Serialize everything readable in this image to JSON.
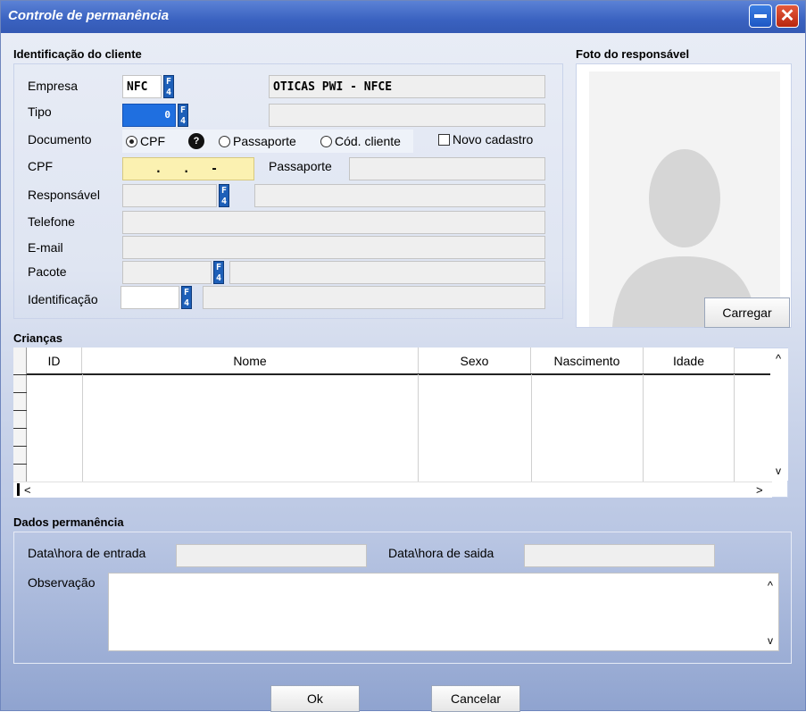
{
  "window": {
    "title": "Controle de permanência"
  },
  "client": {
    "section_title": "Identificação do cliente",
    "empresa_label": "Empresa",
    "empresa_code": "NFC",
    "empresa_name": "OTICAS PWI - NFCE",
    "tipo_label": "Tipo",
    "tipo_value": "0",
    "documento_label": "Documento",
    "doc_options": [
      "CPF",
      "Passaporte",
      "Cód. cliente"
    ],
    "doc_selected": "CPF",
    "help_glyph": "?",
    "novo_cadastro_label": "Novo cadastro",
    "cpf_label": "CPF",
    "cpf_mask": "   .   .   -",
    "passaporte_label": "Passaporte",
    "responsavel_label": "Responsável",
    "telefone_label": "Telefone",
    "email_label": "E-mail",
    "pacote_label": "Pacote",
    "identificacao_label": "Identificação",
    "f4_label": "F4"
  },
  "photo": {
    "section_title": "Foto do responsável",
    "load_button": "Carregar"
  },
  "children": {
    "section_title": "Crianças",
    "columns": [
      "ID",
      "Nome",
      "Sexo",
      "Nascimento",
      "Idade"
    ],
    "rows": [],
    "scroll_up": "^",
    "scroll_down": "v",
    "scroll_left": "<",
    "scroll_right": ">"
  },
  "stay": {
    "section_title": "Dados permanência",
    "entrada_label": "Data\\hora de entrada",
    "saida_label": "Data\\hora de saida",
    "observacao_label": "Observação",
    "scroll_up": "^",
    "scroll_down": "v"
  },
  "footer": {
    "ok_label": "Ok",
    "cancel_label": "Cancelar"
  },
  "colors": {
    "title_bar": "#3a62c0",
    "selected_field": "#1f6fe0",
    "cpf_field": "#fbf1b1",
    "f4_badge": "#1d5fb8"
  }
}
